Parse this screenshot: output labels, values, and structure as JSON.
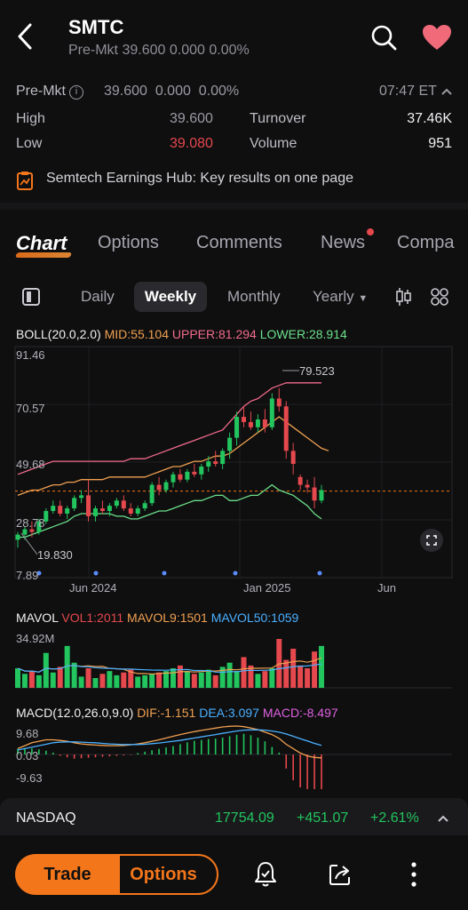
{
  "header": {
    "ticker": "SMTC",
    "premkt_label": "Pre-Mkt",
    "premkt_price": "39.600",
    "premkt_change": "0.000",
    "premkt_pct": "0.00%"
  },
  "quote": {
    "premkt_label": "Pre-Mkt",
    "price": "39.600",
    "change": "0.000",
    "pct": "0.00%",
    "time": "07:47 ET",
    "high_label": "High",
    "high": "39.600",
    "low_label": "Low",
    "low": "39.080",
    "turnover_label": "Turnover",
    "turnover": "37.46K",
    "volume_label": "Volume",
    "volume": "951"
  },
  "banner": {
    "text": "Semtech Earnings Hub: Key results on one page"
  },
  "tabs": [
    "Chart",
    "Options",
    "Comments",
    "News",
    "Compa"
  ],
  "periods": {
    "daily": "Daily",
    "weekly": "Weekly",
    "monthly": "Monthly",
    "yearly": "Yearly"
  },
  "boll": {
    "label": "BOLL(20.0,2.0)",
    "mid": "MID:55.104",
    "upper": "UPPER:81.294",
    "lower": "LOWER:28.914"
  },
  "price_axis": [
    "91.46",
    "70.57",
    "49.68",
    "28.78",
    "7.89"
  ],
  "annotations": {
    "high": "79.523",
    "low": "19.830"
  },
  "time_axis": [
    "Jun 2024",
    "Jan 2025",
    "Jun"
  ],
  "mavol": {
    "label": "MAVOL",
    "vol1": "VOL1:2011",
    "mavol9": "MAVOL9:1501",
    "mavol50": "MAVOL50:1059",
    "max": "34.92M"
  },
  "macd": {
    "label": "MACD(12.0,26.0,9.0)",
    "dif": "DIF:-1.151",
    "dea": "DEA:3.097",
    "macd": "MACD:-8.497",
    "axis": [
      "9.68",
      "0.03",
      "-9.63"
    ]
  },
  "nasdaq": {
    "name": "NASDAQ",
    "price": "17754.09",
    "change": "+451.07",
    "pct": "+2.61%"
  },
  "bottom": {
    "trade": "Trade",
    "options": "Options"
  },
  "colors": {
    "up": "#22c55e",
    "down": "#e5484d",
    "accent": "#f4761a",
    "mid": "#f0a050",
    "upper": "#f06a8a",
    "lower": "#6be08a"
  },
  "chart_data": {
    "type": "candlestick",
    "candles": [
      [
        21,
        24,
        18,
        23
      ],
      [
        23,
        26,
        21,
        25
      ],
      [
        25,
        28,
        22,
        24
      ],
      [
        24,
        29,
        23,
        28
      ],
      [
        28,
        33,
        27,
        32
      ],
      [
        32,
        36,
        31,
        34
      ],
      [
        34,
        36,
        30,
        31
      ],
      [
        31,
        34,
        29,
        33
      ],
      [
        33,
        38,
        32,
        37
      ],
      [
        37,
        40,
        35,
        38
      ],
      [
        38,
        44,
        28,
        30
      ],
      [
        30,
        34,
        28,
        33
      ],
      [
        33,
        36,
        31,
        32
      ],
      [
        32,
        35,
        30,
        34
      ],
      [
        34,
        37,
        33,
        36
      ],
      [
        36,
        38,
        32,
        33
      ],
      [
        33,
        35,
        30,
        31
      ],
      [
        31,
        34,
        30,
        33
      ],
      [
        33,
        36,
        32,
        35
      ],
      [
        35,
        43,
        34,
        42
      ],
      [
        42,
        45,
        38,
        40
      ],
      [
        40,
        44,
        39,
        43
      ],
      [
        43,
        47,
        41,
        46
      ],
      [
        46,
        48,
        43,
        44
      ],
      [
        44,
        48,
        43,
        47
      ],
      [
        47,
        50,
        45,
        46
      ],
      [
        46,
        50,
        44,
        49
      ],
      [
        49,
        53,
        47,
        51
      ],
      [
        51,
        55,
        49,
        50
      ],
      [
        50,
        56,
        48,
        55
      ],
      [
        55,
        62,
        52,
        60
      ],
      [
        60,
        70,
        57,
        68
      ],
      [
        68,
        72,
        64,
        66
      ],
      [
        66,
        70,
        63,
        64
      ],
      [
        64,
        69,
        62,
        67
      ],
      [
        67,
        71,
        62,
        64
      ],
      [
        64,
        77,
        63,
        75
      ],
      [
        75,
        79,
        70,
        72
      ],
      [
        72,
        74,
        52,
        55
      ],
      [
        55,
        58,
        46,
        50
      ],
      [
        45,
        46,
        40,
        42
      ],
      [
        42,
        44,
        39,
        41
      ],
      [
        41,
        45,
        33,
        36
      ],
      [
        36,
        42,
        35,
        40
      ]
    ],
    "mid": [
      38,
      39,
      40,
      40,
      41,
      42,
      42,
      43,
      43,
      44,
      44,
      44,
      44,
      45,
      45,
      45,
      45,
      45,
      45,
      46,
      47,
      48,
      49,
      49,
      50,
      51,
      51,
      52,
      53,
      53,
      54,
      56,
      58,
      60,
      62,
      64,
      66,
      68,
      66,
      64,
      62,
      60,
      58,
      56,
      55
    ],
    "upper": [
      46,
      47,
      48,
      49,
      50,
      51,
      51,
      51,
      51,
      51,
      51,
      51,
      51,
      51,
      51,
      51,
      52,
      52,
      52,
      53,
      54,
      55,
      56,
      57,
      58,
      59,
      60,
      61,
      62,
      63,
      66,
      69,
      72,
      74,
      75,
      77,
      79,
      80,
      81,
      81,
      81,
      81,
      81,
      81
    ],
    "lower": [
      22,
      22,
      23,
      24,
      25,
      26,
      27,
      28,
      30,
      31,
      31,
      31,
      31,
      31,
      30,
      30,
      29,
      29,
      30,
      31,
      32,
      32,
      33,
      34,
      35,
      36,
      36,
      37,
      38,
      38,
      36,
      36,
      37,
      38,
      38,
      40,
      42,
      40,
      39,
      38,
      36,
      34,
      31,
      29
    ],
    "volume": [
      14,
      10,
      12,
      9,
      25,
      11,
      15,
      30,
      18,
      8,
      14,
      7,
      10,
      12,
      9,
      11,
      13,
      8,
      9,
      10,
      11,
      12,
      14,
      16,
      12,
      10,
      11,
      13,
      9,
      15,
      18,
      12,
      22,
      16,
      10,
      12,
      14,
      35,
      20,
      28,
      16,
      14,
      26,
      30
    ],
    "macd_hist": [
      1.2,
      1.4,
      1.3,
      1.1,
      0.8,
      0.4,
      -0.3,
      -0.6,
      -0.9,
      -0.8,
      -0.7,
      -0.6,
      -0.5,
      -0.4,
      -0.3,
      -0.2,
      -0.1,
      0.3,
      0.6,
      0.9,
      1.2,
      1.5,
      1.8,
      2.2,
      2.6,
      2.9,
      3.1,
      3.3,
      3.4,
      3.6,
      3.9,
      4.2,
      4.4,
      4.1,
      3.6,
      2.8,
      1.6,
      0.4,
      -3.0,
      -5.5,
      -7.0,
      -8.0,
      -8.5,
      -8.5
    ],
    "dif": [
      2,
      3,
      4,
      4.5,
      5,
      5,
      4.8,
      4.5,
      4,
      3.6,
      3.4,
      3.2,
      3.1,
      3,
      3,
      3.1,
      3.3,
      3.6,
      4,
      4.5,
      5,
      5.6,
      6.2,
      6.8,
      7.3,
      7.8,
      8.2,
      8.6,
      9,
      9.4,
      9.6,
      9.7,
      9.5,
      9,
      8.5,
      7.6,
      6.8,
      5.5,
      3.5,
      2,
      0.5,
      -0.5,
      -1,
      -1.15
    ],
    "dea": [
      1.5,
      2,
      2.5,
      3,
      3.5,
      4,
      4.2,
      4.3,
      4.3,
      4.2,
      4.1,
      4,
      3.8,
      3.6,
      3.5,
      3.4,
      3.4,
      3.4,
      3.5,
      3.7,
      3.9,
      4.2,
      4.5,
      4.8,
      5.2,
      5.6,
      6,
      6.4,
      6.8,
      7.2,
      7.6,
      8,
      8.3,
      8.4,
      8.4,
      8.3,
      8,
      7.6,
      7,
      6.2,
      5.4,
      4.6,
      3.8,
      3.1
    ]
  }
}
